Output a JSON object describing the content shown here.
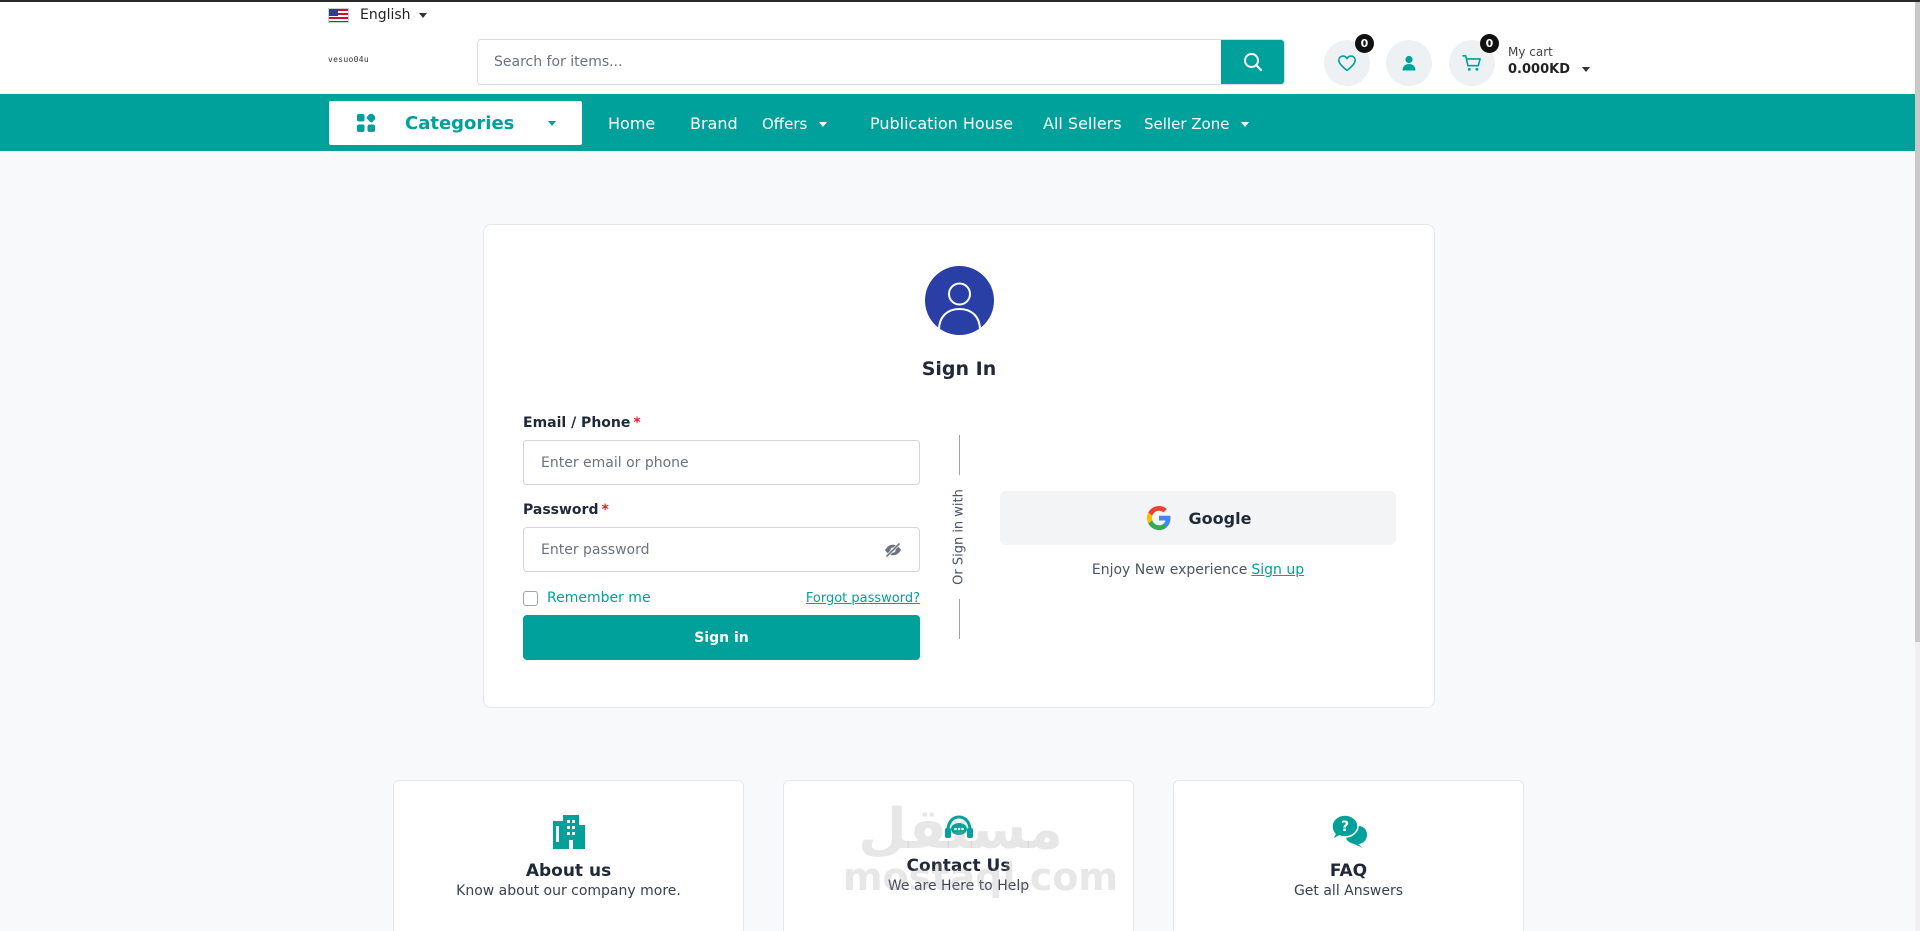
{
  "topbar": {
    "language": "English"
  },
  "header": {
    "logo_text": "vesuo04u",
    "search_placeholder": "Search for items...",
    "wishlist_count": "0",
    "cart_count": "0",
    "cart_label": "My cart",
    "cart_total": "0.000KD"
  },
  "nav": {
    "categories_label": "Categories",
    "items": [
      "Home",
      "Brand",
      "Offers",
      "Publication House",
      "All Sellers",
      "Seller Zone"
    ]
  },
  "signin": {
    "title": "Sign In",
    "email_label": "Email / Phone",
    "email_placeholder": "Enter email or phone",
    "password_label": "Password",
    "password_placeholder": "Enter password",
    "required_mark": "*",
    "remember_label": "Remember me",
    "forgot_label": "Forgot password?",
    "submit_label": "Sign in",
    "divider_text": "Or Sign in with",
    "google_label": "Google",
    "signup_prompt": "Enjoy New experience",
    "signup_link": "Sign up"
  },
  "info_cards": [
    {
      "title": "About us",
      "subtitle": "Know about our company more."
    },
    {
      "title": "Contact Us",
      "subtitle": "We are Here to Help"
    },
    {
      "title": "FAQ",
      "subtitle": "Get all Answers"
    }
  ],
  "watermark": {
    "arabic": "مستقل",
    "latin": "mostaql.com"
  },
  "colors": {
    "accent": "#00a19a",
    "avatar": "#2a3fa5",
    "required": "#dc2626",
    "background": "#f7f9fb"
  },
  "icons": [
    "us-flag-icon",
    "search-icon",
    "heart-icon",
    "user-icon",
    "cart-icon",
    "grid-icon",
    "eye-off-icon",
    "google-icon",
    "building-icon",
    "headset-icon",
    "faq-icon"
  ]
}
